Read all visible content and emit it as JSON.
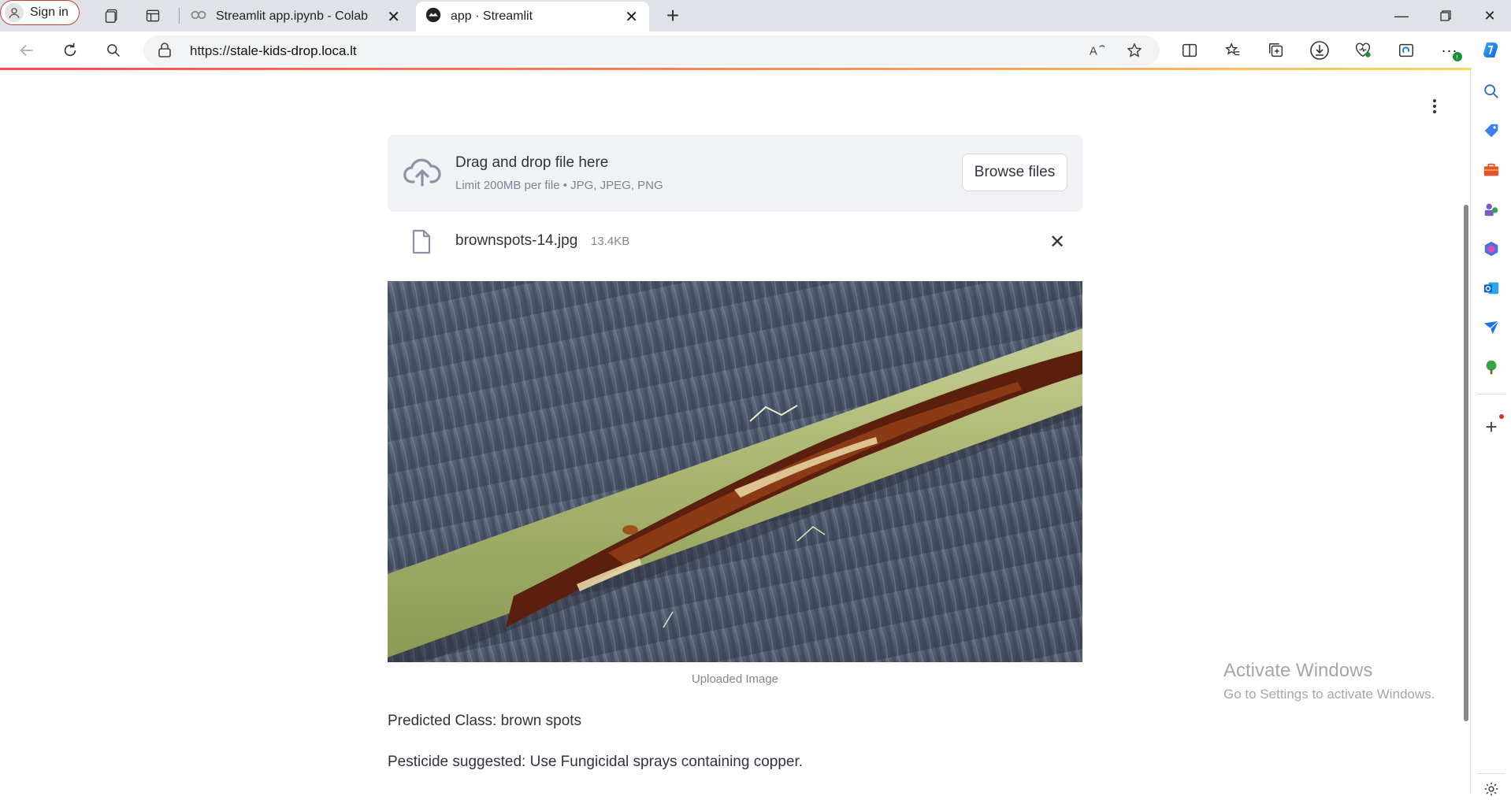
{
  "browser": {
    "signin_label": "Sign in",
    "tabs": [
      {
        "title": "Streamlit app.ipynb - Colab",
        "icon": "colab-icon",
        "active": false
      },
      {
        "title": "app · Streamlit",
        "icon": "streamlit-icon",
        "active": true
      }
    ],
    "url_scheme": "https://",
    "url_host": "stale-kids-drop.loca.lt"
  },
  "uploader": {
    "drag_text": "Drag and drop file here",
    "limit_text": "Limit 200MB per file • JPG, JPEG, PNG",
    "browse_label": "Browse files"
  },
  "file": {
    "name": "brownspots-14.jpg",
    "size": "13.4KB"
  },
  "image": {
    "caption": "Uploaded Image"
  },
  "result": {
    "predicted": "Predicted Class: brown spots",
    "pesticide": "Pesticide suggested: Use Fungicidal sprays containing copper."
  },
  "watermark": {
    "title": "Activate Windows",
    "subtitle": "Go to Settings to activate Windows."
  },
  "colors": {
    "accent": "#ff4b4b",
    "text": "#31333f",
    "muted": "#808495",
    "uploader_bg": "#f0f2f6"
  }
}
